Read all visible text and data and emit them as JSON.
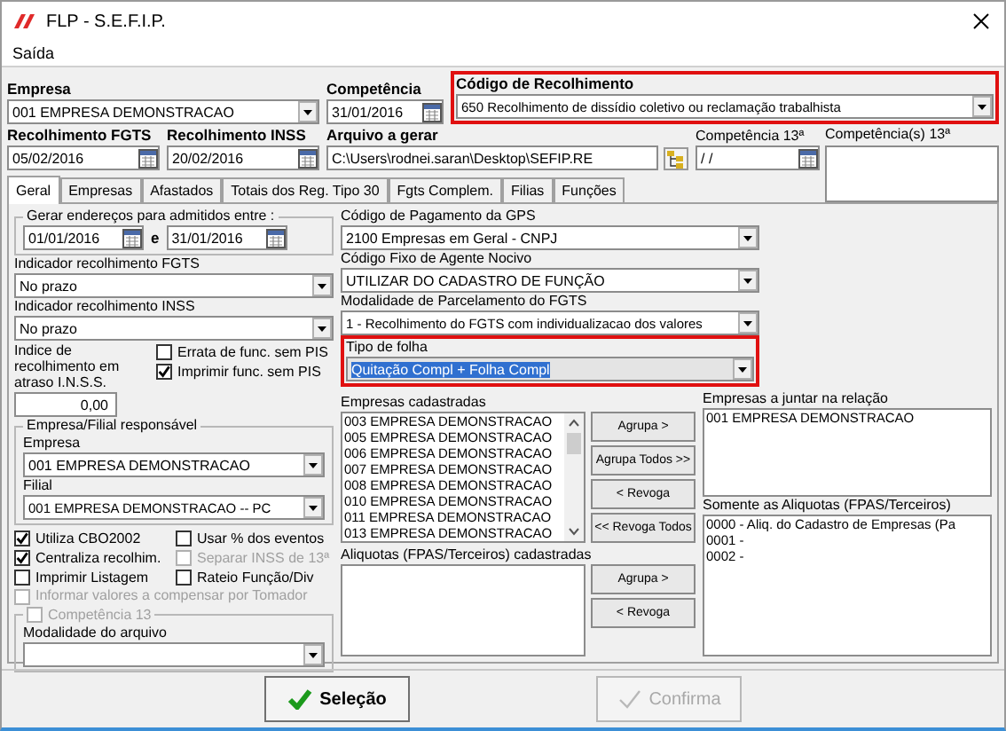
{
  "window": {
    "title": "FLP - S.E.F.I.P."
  },
  "menu": [
    {
      "label": "Saída"
    }
  ],
  "header": {
    "empresa": {
      "label": "Empresa",
      "value": "001 EMPRESA DEMONSTRACAO"
    },
    "competencia": {
      "label": "Competência",
      "value": "31/01/2016"
    },
    "codigo_recolhimento": {
      "label": "Código de Recolhimento",
      "value": "650 Recolhimento de dissídio coletivo ou reclamação trabalhista",
      "highlighted": true
    },
    "recolhimento_fgts": {
      "label": "Recolhimento FGTS",
      "value": "05/02/2016"
    },
    "recolhimento_inss": {
      "label": "Recolhimento INSS",
      "value": "20/02/2016"
    },
    "arquivo": {
      "label": "Arquivo a gerar",
      "value": "C:\\Users\\rodnei.saran\\Desktop\\SEFIP.RE"
    },
    "competencia_13": {
      "label": "Competência 13ª",
      "value": "/ /"
    },
    "competencias_13": {
      "label": "Competência(s) 13ª"
    }
  },
  "tabs": [
    {
      "label": "Geral",
      "selected": true
    },
    {
      "label": "Empresas",
      "selected": false
    },
    {
      "label": "Afastados",
      "selected": false
    },
    {
      "label": "Totais dos Reg. Tipo 30",
      "selected": false
    },
    {
      "label": "Fgts Complem.",
      "selected": false
    },
    {
      "label": "Filias",
      "selected": false
    },
    {
      "label": "Funções",
      "selected": false
    }
  ],
  "geral": {
    "admitidos": {
      "label": "Gerar endereços para admitidos entre :",
      "from": "01/01/2016",
      "conjunction": "e",
      "to": "31/01/2016"
    },
    "indicador_fgts": {
      "label": "Indicador recolhimento FGTS",
      "value": "No prazo"
    },
    "indicador_inss": {
      "label": "Indicador recolhimento INSS",
      "value": "No prazo"
    },
    "indice_atraso": {
      "label": "Indice de recolhimento em atraso I.N.S.S.",
      "value": "0,00"
    },
    "pis_options": [
      {
        "label": "Errata de func. sem PIS",
        "checked": false
      },
      {
        "label": "Imprimir func. sem PIS",
        "checked": true
      }
    ],
    "responsavel": {
      "label": "Empresa/Filial responsável",
      "empresa_label": "Empresa",
      "empresa": "001 EMPRESA DEMONSTRACAO",
      "filial_label": "Filial",
      "filial": "001 EMPRESA DEMONSTRACAO -- PC"
    },
    "options": [
      {
        "label": "Utiliza CBO2002",
        "checked": true,
        "disabled": false
      },
      {
        "label": "Usar % dos eventos",
        "checked": false,
        "disabled": false
      },
      {
        "label": "Centraliza recolhim.",
        "checked": true,
        "disabled": false
      },
      {
        "label": "Separar INSS de 13ª",
        "checked": false,
        "disabled": true
      },
      {
        "label": "Imprimir Listagem",
        "checked": false,
        "disabled": false
      },
      {
        "label": "Rateio Função/Div",
        "checked": false,
        "disabled": false
      }
    ],
    "compensar": {
      "label": "Informar valores a compensar por Tomador",
      "checked": false,
      "disabled": true
    },
    "competencia_13": {
      "label": "Competência 13",
      "checked": false,
      "disabled": true
    },
    "modalidade": {
      "label": "Modalidade do arquivo"
    },
    "codigo_gps": {
      "label": "Código de Pagamento da GPS",
      "value": "2100  Empresas em Geral - CNPJ"
    },
    "agente_nocivo": {
      "label": "Código Fixo de Agente Nocivo",
      "value": "UTILIZAR DO CADASTRO DE FUNÇÃO"
    },
    "parcelamento": {
      "label": "Modalidade de Parcelamento do FGTS",
      "value": "1 - Recolhimento do FGTS com individualizacao dos valores"
    },
    "tipo_folha": {
      "label": "Tipo de folha",
      "value": "Quitação Compl + Folha Compl",
      "highlighted": true,
      "text_selected": true
    },
    "empresas_cadastradas": {
      "label": "Empresas cadastradas",
      "items": [
        "003 EMPRESA DEMONSTRACAO",
        "005 EMPRESA DEMONSTRACAO",
        "006 EMPRESA DEMONSTRACAO",
        "007 EMPRESA DEMONSTRACAO",
        "008 EMPRESA DEMONSTRACAO",
        "010 EMPRESA DEMONSTRACAO",
        "011 EMPRESA DEMONSTRACAO",
        "013 EMPRESA DEMONSTRACAO"
      ]
    },
    "empresa_buttons": [
      "Agrupa >",
      "Agrupa Todos >>",
      "< Revoga",
      "<< Revoga Todos"
    ],
    "aliquotas_cadastradas": {
      "label": "Aliquotas (FPAS/Terceiros) cadastradas"
    },
    "aliquota_buttons": [
      "Agrupa >",
      "< Revoga"
    ],
    "empresas_juntar": {
      "label": "Empresas a juntar na relação",
      "items": [
        "001 EMPRESA DEMONSTRACAO"
      ]
    },
    "aliquotas_somente": {
      "label": "Somente as Aliquotas (FPAS/Terceiros)",
      "items": [
        "0000 - Aliq. do Cadastro de Empresas (Pa",
        "0001 -",
        "0002 -"
      ]
    }
  },
  "actions": [
    {
      "label": "Seleção",
      "disabled": false
    },
    {
      "label": "Confirma",
      "disabled": true
    }
  ]
}
